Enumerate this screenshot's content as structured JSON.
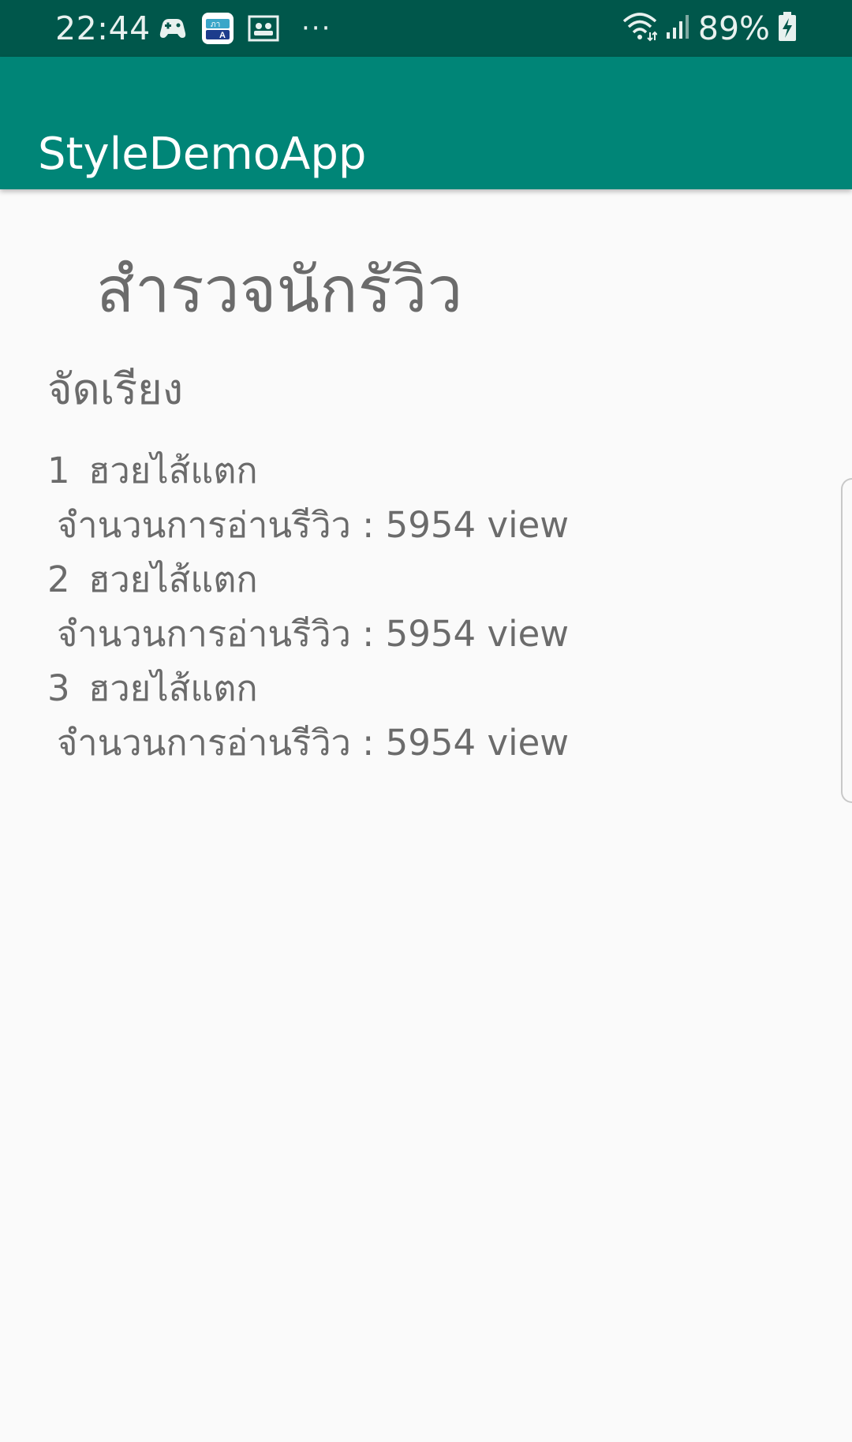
{
  "status_bar": {
    "time": "22:44",
    "battery": "89%",
    "icons": [
      "game-controller-icon",
      "dictionary-app-icon",
      "contact-card-icon",
      "more-dots-icon",
      "wifi-icon",
      "signal-icon",
      "battery-charging-icon"
    ],
    "background": "#00574b"
  },
  "app_bar": {
    "title": "StyleDemoApp",
    "background": "#008577"
  },
  "main": {
    "heading": "สำรวจนักรัวิว",
    "sort_label": "จัดเรียง",
    "items": [
      {
        "rank": "1",
        "title": "ฮวยไส้แตก",
        "views": "จำนวนการอ่านรีวิว : 5954 view"
      },
      {
        "rank": "2",
        "title": "ฮวยไส้แตก",
        "views": "จำนวนการอ่านรีวิว : 5954 view"
      },
      {
        "rank": "3",
        "title": "ฮวยไส้แตก",
        "views": "จำนวนการอ่านรีวิว : 5954 view"
      }
    ],
    "text_color": "#6b6b6b",
    "background": "#fafafa"
  }
}
